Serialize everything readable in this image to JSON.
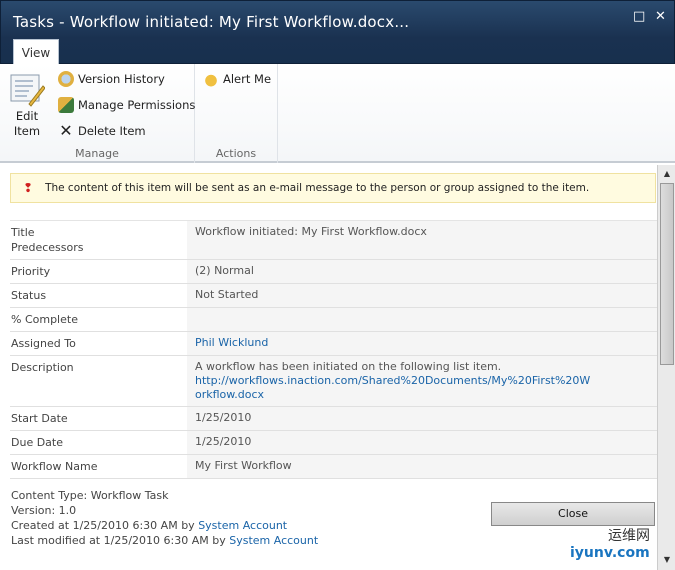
{
  "window": {
    "title": "Tasks - Workflow initiated: My First Workflow.docx...",
    "maximize_glyph": "□",
    "close_glyph": "✕"
  },
  "ribbon": {
    "tab": "View",
    "groups": {
      "manage": "Manage",
      "actions": "Actions"
    },
    "edit_item": [
      "Edit",
      "Item"
    ],
    "version_history": "Version History",
    "manage_permissions": "Manage Permissions",
    "delete_item": "Delete Item",
    "alert_me": "Alert Me"
  },
  "notice": "The content of this item will be sent as an e-mail message to the person or group assigned to the item.",
  "fields": [
    {
      "label": "Title",
      "value": "Workflow initiated:  My First Workflow.docx"
    },
    {
      "label": "Predecessors",
      "value": ""
    },
    {
      "label": "Priority",
      "value": "(2) Normal"
    },
    {
      "label": "Status",
      "value": "Not Started"
    },
    {
      "label": "% Complete",
      "value": ""
    },
    {
      "label": "Assigned To",
      "value": "Phil Wicklund"
    },
    {
      "label": "Description",
      "value": "A workflow has been initiated on the following list item.",
      "link": "http://workflows.inaction.com/Shared%20Documents/My%20First%20Workflow.docx"
    },
    {
      "label": "Start Date",
      "value": "1/25/2010"
    },
    {
      "label": "Due Date",
      "value": "1/25/2010"
    },
    {
      "label": "Workflow Name",
      "value": "My First Workflow"
    }
  ],
  "meta": {
    "content_type": "Content Type: Workflow Task",
    "version": "Version: 1.0",
    "created": "Created at 1/25/2010 6:30 AM by ",
    "created_by": "System Account",
    "modified": "Last modified at 1/25/2010 6:30 AM by ",
    "modified_by": "System Account"
  },
  "close_label": "Close",
  "watermark": {
    "line1": "运维网",
    "line2": "iyunv.com"
  }
}
